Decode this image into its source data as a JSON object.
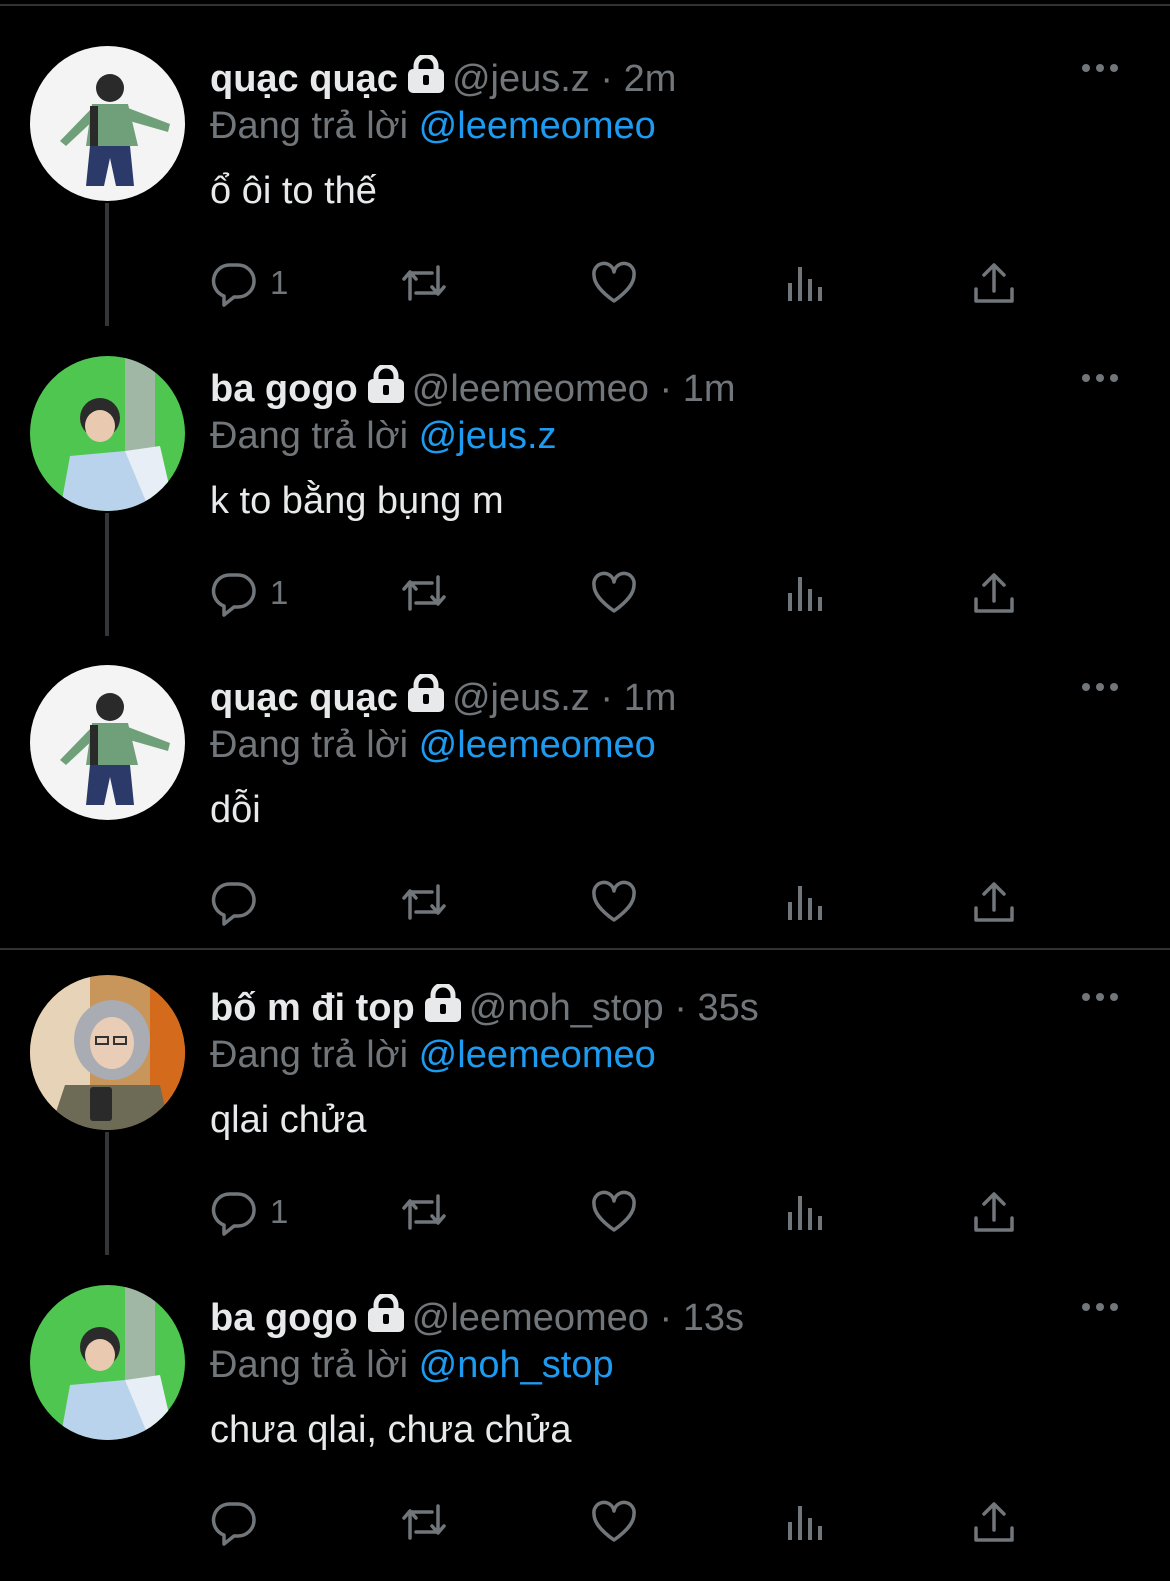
{
  "colors": {
    "background": "#000000",
    "text": "#e7e9ea",
    "muted": "#71767b",
    "accent": "#1d9bf0"
  },
  "tweets": [
    {
      "name": "quạc quạc",
      "handle": "@jeus.z",
      "sep": "·",
      "time": "2m",
      "reply_prefix": "Đang trả lời",
      "reply_to": "@leemeomeo",
      "text": "ổ ôi to thế",
      "reply_count": "1",
      "avatar": "avatar-green-jacket"
    },
    {
      "name": "ba gogo",
      "handle": "@leemeomeo",
      "sep": "·",
      "time": "1m",
      "reply_prefix": "Đang trả lời",
      "reply_to": "@jeus.z",
      "text": "k to bằng bụng m",
      "reply_count": "1",
      "avatar": "avatar-green-background"
    },
    {
      "name": "quạc quạc",
      "handle": "@jeus.z",
      "sep": "·",
      "time": "1m",
      "reply_prefix": "Đang trả lời",
      "reply_to": "@leemeomeo",
      "text": "dỗi",
      "reply_count": "",
      "avatar": "avatar-green-jacket"
    },
    {
      "name": "bố m đi top",
      "handle": "@noh_stop",
      "sep": "·",
      "time": "35s",
      "reply_prefix": "Đang trả lời",
      "reply_to": "@leemeomeo",
      "text": "qlai chửa",
      "reply_count": "1",
      "avatar": "avatar-hoodie-selfie"
    },
    {
      "name": "ba gogo",
      "handle": "@leemeomeo",
      "sep": "·",
      "time": "13s",
      "reply_prefix": "Đang trả lời",
      "reply_to": "@noh_stop",
      "text": "chưa qlai, chưa chửa",
      "reply_count": "",
      "avatar": "avatar-green-background"
    }
  ],
  "icons": [
    "lock-icon",
    "more-icon",
    "reply-icon",
    "retweet-icon",
    "like-icon",
    "views-icon",
    "share-icon"
  ]
}
